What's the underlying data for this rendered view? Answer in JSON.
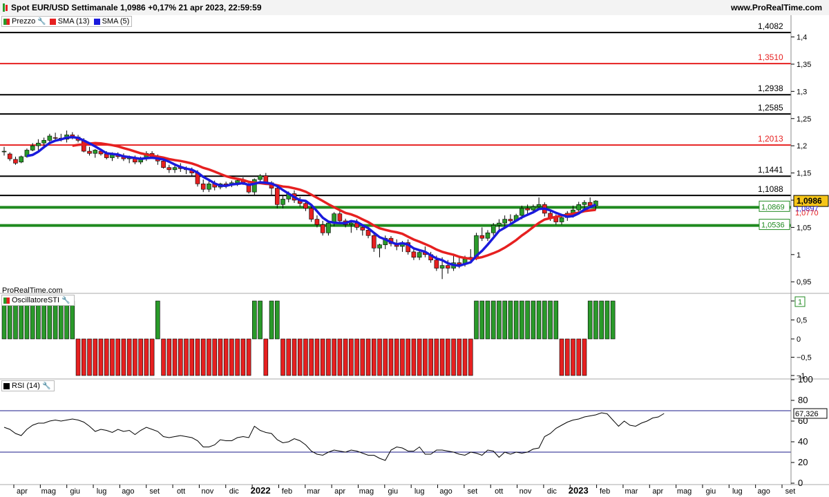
{
  "header": {
    "title": "Spot EUR/USD Settimanale 1,0986 +0,17% 21 apr 2023, 22:59:59",
    "site": "www.ProRealTime.com",
    "watermark": "ProRealTime.com"
  },
  "legends": {
    "price": "Prezzo",
    "sma13": "SMA (13)",
    "sma5": "SMA (5)",
    "osc": "OscillatoreSTI",
    "rsi": "RSI (14)"
  },
  "price_axis": {
    "ticks": [
      "1,4",
      "1,35",
      "1,3",
      "1,25",
      "1,2",
      "1,15",
      "1,1",
      "1,05",
      "1",
      "0,95"
    ]
  },
  "levels": [
    {
      "value": 1.4082,
      "label": "1,4082",
      "color": "#000000"
    },
    {
      "value": 1.351,
      "label": "1,3510",
      "color": "#e62020"
    },
    {
      "value": 1.2938,
      "label": "1,2938",
      "color": "#000000"
    },
    {
      "value": 1.2585,
      "label": "1,2585",
      "color": "#000000"
    },
    {
      "value": 1.2013,
      "label": "1,2013",
      "color": "#e62020"
    },
    {
      "value": 1.1441,
      "label": "1,1441",
      "color": "#000000"
    },
    {
      "value": 1.1088,
      "label": "1,1088",
      "color": "#000000"
    },
    {
      "value": 1.0869,
      "label": "1,0869",
      "color": "#1f8a1f",
      "boxed": true
    },
    {
      "value": 1.0536,
      "label": "1,0536",
      "color": "#1f8a1f",
      "boxed": true
    }
  ],
  "last_price": {
    "value": "1,0986",
    "sma5": "1,0897",
    "sma13": "1,0770"
  },
  "osc_axis": {
    "ticks": [
      "1",
      "0,5",
      "0",
      "−0,5",
      "−1"
    ],
    "last": "1"
  },
  "rsi_axis": {
    "ticks": [
      "100",
      "80",
      "60",
      "40",
      "20",
      "0"
    ],
    "last": "67,326",
    "upper": 70,
    "lower": 30
  },
  "x_axis": {
    "labels": [
      "apr",
      "mag",
      "giu",
      "lug",
      "ago",
      "set",
      "ott",
      "nov",
      "dic",
      "2022",
      "feb",
      "mar",
      "apr",
      "mag",
      "giu",
      "lug",
      "ago",
      "set",
      "ott",
      "nov",
      "dic",
      "2023",
      "feb",
      "mar",
      "apr",
      "mag",
      "giu",
      "lug",
      "ago",
      "set"
    ],
    "bold": [
      "2022",
      "2023"
    ]
  },
  "chart_data": {
    "type": "candlestick",
    "timeframe": "weekly",
    "ylim": [
      0.93,
      1.44
    ],
    "sma_periods": [
      13,
      5
    ],
    "ohlc": [
      [
        1.19,
        1.198,
        1.182,
        1.19
      ],
      [
        1.185,
        1.188,
        1.172,
        1.176
      ],
      [
        1.175,
        1.18,
        1.165,
        1.168
      ],
      [
        1.17,
        1.182,
        1.168,
        1.18
      ],
      [
        1.18,
        1.195,
        1.178,
        1.192
      ],
      [
        1.192,
        1.205,
        1.19,
        1.2
      ],
      [
        1.2,
        1.212,
        1.192,
        1.205
      ],
      [
        1.205,
        1.215,
        1.198,
        1.21
      ],
      [
        1.21,
        1.222,
        1.205,
        1.218
      ],
      [
        1.215,
        1.224,
        1.21,
        1.214
      ],
      [
        1.214,
        1.222,
        1.208,
        1.212
      ],
      [
        1.212,
        1.228,
        1.206,
        1.22
      ],
      [
        1.22,
        1.225,
        1.212,
        1.216
      ],
      [
        1.216,
        1.22,
        1.206,
        1.21
      ],
      [
        1.21,
        1.214,
        1.188,
        1.19
      ],
      [
        1.19,
        1.198,
        1.182,
        1.186
      ],
      [
        1.186,
        1.194,
        1.178,
        1.192
      ],
      [
        1.19,
        1.195,
        1.182,
        1.185
      ],
      [
        1.185,
        1.19,
        1.175,
        1.178
      ],
      [
        1.178,
        1.188,
        1.172,
        1.184
      ],
      [
        1.184,
        1.188,
        1.176,
        1.18
      ],
      [
        1.18,
        1.186,
        1.172,
        1.176
      ],
      [
        1.176,
        1.182,
        1.168,
        1.178
      ],
      [
        1.178,
        1.182,
        1.166,
        1.17
      ],
      [
        1.17,
        1.18,
        1.166,
        1.176
      ],
      [
        1.176,
        1.19,
        1.172,
        1.186
      ],
      [
        1.186,
        1.19,
        1.176,
        1.18
      ],
      [
        1.18,
        1.184,
        1.165,
        1.172
      ],
      [
        1.172,
        1.178,
        1.158,
        1.16
      ],
      [
        1.16,
        1.165,
        1.15,
        1.156
      ],
      [
        1.156,
        1.165,
        1.15,
        1.16
      ],
      [
        1.16,
        1.168,
        1.152,
        1.158
      ],
      [
        1.158,
        1.162,
        1.148,
        1.156
      ],
      [
        1.156,
        1.16,
        1.145,
        1.15
      ],
      [
        1.15,
        1.155,
        1.125,
        1.13
      ],
      [
        1.13,
        1.138,
        1.115,
        1.12
      ],
      [
        1.12,
        1.135,
        1.115,
        1.13
      ],
      [
        1.13,
        1.136,
        1.118,
        1.124
      ],
      [
        1.124,
        1.132,
        1.12,
        1.13
      ],
      [
        1.13,
        1.134,
        1.122,
        1.128
      ],
      [
        1.128,
        1.136,
        1.124,
        1.132
      ],
      [
        1.132,
        1.14,
        1.126,
        1.136
      ],
      [
        1.136,
        1.142,
        1.128,
        1.13
      ],
      [
        1.13,
        1.134,
        1.112,
        1.115
      ],
      [
        1.115,
        1.14,
        1.11,
        1.138
      ],
      [
        1.138,
        1.148,
        1.132,
        1.145
      ],
      [
        1.145,
        1.15,
        1.128,
        1.132
      ],
      [
        1.132,
        1.135,
        1.11,
        1.122
      ],
      [
        1.122,
        1.128,
        1.085,
        1.092
      ],
      [
        1.092,
        1.108,
        1.085,
        1.102
      ],
      [
        1.102,
        1.116,
        1.096,
        1.112
      ],
      [
        1.112,
        1.118,
        1.095,
        1.1
      ],
      [
        1.1,
        1.106,
        1.088,
        1.094
      ],
      [
        1.094,
        1.1,
        1.08,
        1.085
      ],
      [
        1.085,
        1.09,
        1.06,
        1.065
      ],
      [
        1.065,
        1.072,
        1.05,
        1.055
      ],
      [
        1.055,
        1.062,
        1.035,
        1.04
      ],
      [
        1.04,
        1.06,
        1.035,
        1.058
      ],
      [
        1.058,
        1.078,
        1.052,
        1.075
      ],
      [
        1.075,
        1.08,
        1.058,
        1.062
      ],
      [
        1.062,
        1.066,
        1.05,
        1.055
      ],
      [
        1.055,
        1.062,
        1.04,
        1.058
      ],
      [
        1.058,
        1.065,
        1.045,
        1.05
      ],
      [
        1.05,
        1.055,
        1.035,
        1.045
      ],
      [
        1.045,
        1.05,
        1.03,
        1.035
      ],
      [
        1.035,
        1.038,
        1.005,
        1.012
      ],
      [
        1.012,
        1.02,
        0.995,
        1.018
      ],
      [
        1.018,
        1.035,
        1.01,
        1.03
      ],
      [
        1.03,
        1.034,
        1.015,
        1.02
      ],
      [
        1.02,
        1.028,
        1.008,
        1.015
      ],
      [
        1.015,
        1.025,
        1.005,
        1.022
      ],
      [
        1.022,
        1.028,
        1.0,
        1.005
      ],
      [
        1.005,
        1.01,
        0.99,
        0.995
      ],
      [
        0.995,
        1.008,
        0.99,
        1.004
      ],
      [
        1.004,
        1.015,
        0.995,
        1.0
      ],
      [
        1.0,
        1.005,
        0.985,
        0.99
      ],
      [
        0.99,
        0.998,
        0.97,
        0.975
      ],
      [
        0.975,
        0.995,
        0.955,
        0.98
      ],
      [
        0.98,
        0.99,
        0.965,
        0.975
      ],
      [
        0.975,
        1.0,
        0.97,
        0.985
      ],
      [
        0.985,
        0.995,
        0.975,
        0.982
      ],
      [
        0.982,
        0.998,
        0.978,
        0.992
      ],
      [
        0.992,
        1.01,
        0.985,
        0.995
      ],
      [
        0.995,
        1.04,
        0.99,
        1.035
      ],
      [
        1.035,
        1.05,
        1.025,
        1.03
      ],
      [
        1.03,
        1.045,
        1.025,
        1.04
      ],
      [
        1.04,
        1.058,
        1.035,
        1.054
      ],
      [
        1.054,
        1.065,
        1.045,
        1.058
      ],
      [
        1.058,
        1.072,
        1.05,
        1.065
      ],
      [
        1.065,
        1.074,
        1.058,
        1.062
      ],
      [
        1.062,
        1.075,
        1.06,
        1.072
      ],
      [
        1.072,
        1.09,
        1.065,
        1.085
      ],
      [
        1.085,
        1.092,
        1.075,
        1.082
      ],
      [
        1.082,
        1.092,
        1.078,
        1.088
      ],
      [
        1.088,
        1.105,
        1.082,
        1.092
      ],
      [
        1.092,
        1.096,
        1.07,
        1.076
      ],
      [
        1.076,
        1.082,
        1.062,
        1.068
      ],
      [
        1.068,
        1.074,
        1.055,
        1.06
      ],
      [
        1.06,
        1.072,
        1.055,
        1.068
      ],
      [
        1.068,
        1.08,
        1.062,
        1.076
      ],
      [
        1.076,
        1.09,
        1.068,
        1.082
      ],
      [
        1.082,
        1.097,
        1.078,
        1.092
      ],
      [
        1.092,
        1.1,
        1.085,
        1.096
      ],
      [
        1.096,
        1.105,
        1.088,
        1.09
      ],
      [
        1.09,
        1.1,
        1.082,
        1.0986
      ]
    ],
    "oscillator": [
      1,
      1,
      1,
      1,
      1,
      1,
      1,
      1,
      1,
      1,
      1,
      1,
      1,
      -1,
      -1,
      -1,
      -1,
      -1,
      -1,
      -1,
      -1,
      -1,
      -1,
      -1,
      -1,
      -1,
      -1,
      1,
      -1,
      -1,
      -1,
      -1,
      -1,
      -1,
      -1,
      -1,
      -1,
      -1,
      -1,
      -1,
      -1,
      -1,
      -1,
      -1,
      1,
      1,
      -1,
      1,
      1,
      -1,
      -1,
      -1,
      -1,
      -1,
      -1,
      -1,
      -1,
      -1,
      -1,
      -1,
      -1,
      -1,
      -1,
      -1,
      -1,
      -1,
      -1,
      -1,
      -1,
      -1,
      -1,
      -1,
      -1,
      -1,
      -1,
      -1,
      -1,
      -1,
      -1,
      -1,
      -1,
      -1,
      -1,
      1,
      1,
      1,
      1,
      1,
      1,
      1,
      1,
      1,
      1,
      1,
      1,
      1,
      1,
      1,
      -1,
      -1,
      -1,
      -1,
      -1,
      1,
      1,
      1,
      1,
      1
    ],
    "rsi": [
      54,
      52,
      48,
      46,
      52,
      56,
      58,
      58,
      60,
      61,
      60,
      61,
      62,
      61,
      59,
      55,
      50,
      52,
      51,
      49,
      52,
      50,
      51,
      47,
      51,
      54,
      52,
      50,
      45,
      44,
      45,
      46,
      45,
      44,
      41,
      35,
      35,
      37,
      42,
      41,
      41,
      44,
      45,
      44,
      55,
      51,
      49,
      48,
      42,
      39,
      40,
      43,
      41,
      37,
      31,
      28,
      27,
      30,
      32,
      31,
      30,
      32,
      31,
      29,
      27,
      27,
      24,
      22,
      32,
      35,
      34,
      31,
      31,
      35,
      28,
      28,
      32,
      32,
      31,
      30,
      28,
      27,
      30,
      29,
      27,
      32,
      31,
      25,
      30,
      28,
      30,
      29,
      30,
      33,
      34,
      45,
      48,
      53,
      56,
      59,
      61,
      62,
      64,
      65,
      66,
      68,
      67,
      61,
      55,
      60,
      56,
      55,
      58,
      60,
      63,
      64,
      67.326
    ]
  }
}
